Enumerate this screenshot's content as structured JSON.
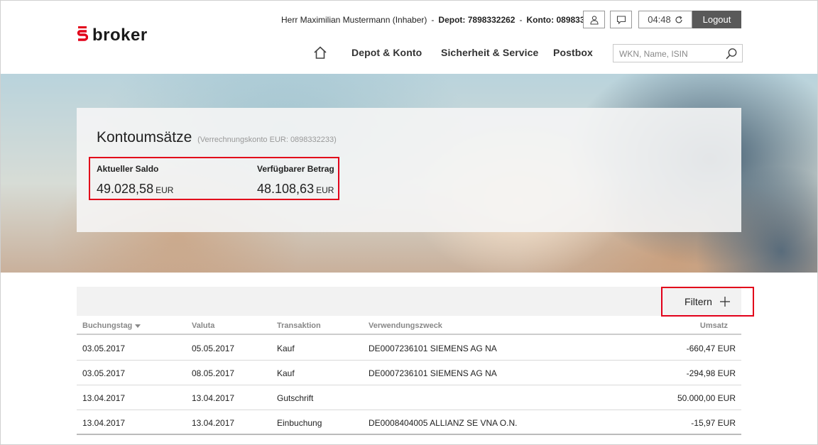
{
  "header": {
    "logo_mark": "S",
    "logo_text": "broker",
    "user": "Herr Maximilian Mustermann (Inhaber)",
    "separator": "-",
    "depot": "Depot: 7898332262",
    "konto": "Konto: 0898332233",
    "timer": "04:48",
    "logout": "Logout",
    "icons": [
      "user-icon",
      "chat-icon",
      "refresh-icon",
      "home-icon",
      "search-icon"
    ]
  },
  "nav": {
    "items": [
      "Depot & Konto",
      "Sicherheit & Service",
      "Postbox"
    ],
    "search_placeholder": "WKN, Name, ISIN"
  },
  "panel": {
    "title": "Kontoumsätze",
    "subtitle": "(Verrechnungskonto EUR: 0898332233)",
    "saldo_label": "Aktueller Saldo",
    "saldo_value": "49.028,58",
    "saldo_currency": "EUR",
    "verfuegbar_label": "Verfügbarer Betrag",
    "verfuegbar_value": "48.108,63",
    "verfuegbar_currency": "EUR"
  },
  "filter": {
    "label": "Filtern"
  },
  "table": {
    "columns": [
      "Buchungstag",
      "Valuta",
      "Transaktion",
      "Verwendungszweck",
      "Umsatz"
    ],
    "rows": [
      [
        "03.05.2017",
        "05.05.2017",
        "Kauf",
        "DE0007236101 SIEMENS AG NA",
        "-660,47 EUR"
      ],
      [
        "03.05.2017",
        "08.05.2017",
        "Kauf",
        "DE0007236101 SIEMENS AG NA",
        "-294,98 EUR"
      ],
      [
        "13.04.2017",
        "13.04.2017",
        "Gutschrift",
        "",
        "50.000,00 EUR"
      ],
      [
        "13.04.2017",
        "13.04.2017",
        "Einbuchung",
        "DE0008404005 ALLIANZ SE VNA O.N.",
        "-15,97 EUR"
      ]
    ]
  },
  "colors": {
    "accent": "#e2001a",
    "logout_bg": "#595959",
    "filter_bar": "#f2f2f2"
  }
}
